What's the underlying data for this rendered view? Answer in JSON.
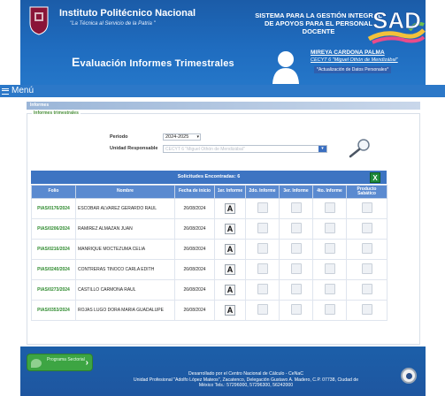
{
  "header": {
    "institution_name": "Instituto Politécnico Nacional",
    "institution_motto": "\"La Técnica al Servicio de la Patria \"",
    "system_title": "SISTEMA PARA LA GESTIÓN INTEGRAL DE APOYOS PARA EL PERSONAL DOCENTE",
    "sad_logo_text": "SAD",
    "app_title_initial": "E",
    "app_title_rest": "valuación Informes Trimestrales",
    "user": {
      "name": "MIREYA CARDONA PALMA",
      "school": "CECYT 6 \"Miguel Othón de Mendizábal\"",
      "update_link": "*Actualización de Datos Personales*"
    }
  },
  "menu": {
    "label": "Menú"
  },
  "content": {
    "section_title": "Informes",
    "fieldset_legend": "Informes trimestrales",
    "periodo_label": "Periodo",
    "periodo_value": "2024-2025",
    "unidad_label": "Unidad Responsable",
    "unidad_value": "CECYT 6 \"Miguel Othón de Mendizábal\"",
    "table": {
      "caption": "Solicitudes Encontradas: 6",
      "excel_icon": "excel-icon",
      "headers": [
        "Folio",
        "Nombre",
        "Fecha de inicio",
        "1er. Informe",
        "2do. Informe",
        "3er. Informe",
        "4to. Informe",
        "Producto Sabático"
      ],
      "rows": [
        {
          "folio": "PIAS/0176/2024",
          "nombre": "ESCOBAR ALVAREZ GERARDO RAUL",
          "fecha": "26/08/2024"
        },
        {
          "folio": "PIAS/0206/2024",
          "nombre": "RAMIREZ ALMAZAN JUAN",
          "fecha": "26/08/2024"
        },
        {
          "folio": "PIAS/0216/2024",
          "nombre": "MANRIQUE MOCTEZUMA CELIA",
          "fecha": "26/08/2024"
        },
        {
          "folio": "PIAS/0240/2024",
          "nombre": "CONTRERAS TINOCO CARLA EDITH",
          "fecha": "26/08/2024"
        },
        {
          "folio": "PIAS/0273/2024",
          "nombre": "CASTILLO CARMONA RAUL",
          "fecha": "26/08/2024"
        },
        {
          "folio": "PIAS/0353/2024",
          "nombre": "ROJAS LUGO DORA MARIA GUADALUPE",
          "fecha": "26/08/2024"
        }
      ],
      "a_button_label": "A"
    }
  },
  "footer": {
    "badge_text": "Programa Sectorial",
    "line1": "Desarrollado por el Centro Nacional de Cálculo - CeNaC",
    "line2": "Unidad Profesional \"Adolfo López Mateos\", Zacatenco, Delegación Gustavo A. Madero, C.P. 07738, Ciudad de",
    "line3": "México Tels.: 57296000, 57296300, 56242000"
  }
}
